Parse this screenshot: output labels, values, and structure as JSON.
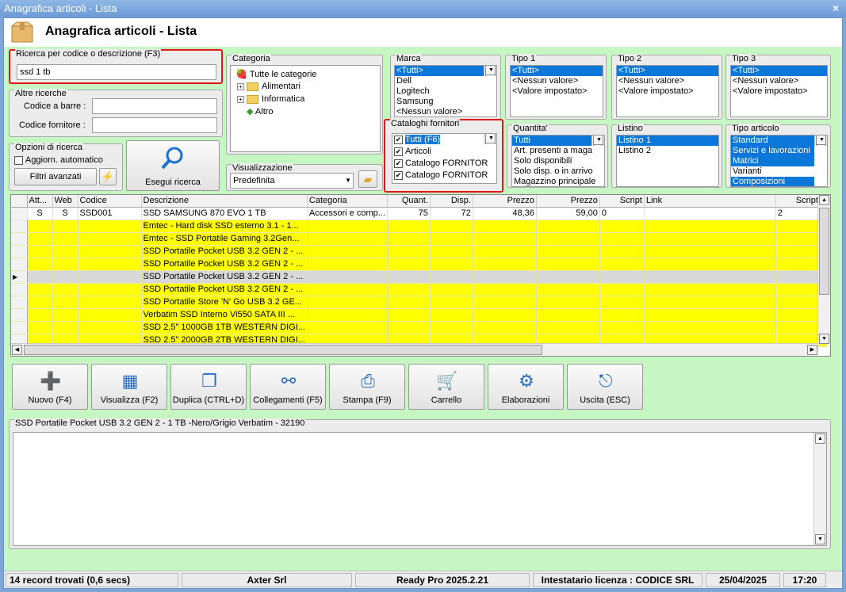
{
  "window": {
    "title": "Anagrafica articoli  - Lista",
    "close": "×"
  },
  "header": {
    "title": "Anagrafica articoli  - Lista"
  },
  "search": {
    "group": "Ricerca per codice o descrizione (F3)",
    "value": "ssd 1 tb"
  },
  "altre": {
    "group": "Altre ricerche",
    "barcode_label": "Codice a barre :",
    "supplier_label": "Codice fornitore :"
  },
  "opzioni": {
    "group": "Opzioni di ricerca",
    "auto_update": "Aggiorn. automatico",
    "filters": "Filtri avanzati"
  },
  "esegui": {
    "label": "Esegui ricerca"
  },
  "categoria": {
    "group": "Categoria",
    "root": "Tutte le categorie",
    "items": [
      "Alimentari",
      "Informatica",
      "Altro"
    ]
  },
  "visualizzazione": {
    "group": "Visualizzazione",
    "value": "Predefinita"
  },
  "marca": {
    "group": "Marca",
    "items": [
      "<Tutti>",
      "Dell",
      "Logitech",
      "Samsung",
      "<Nessun valore>"
    ]
  },
  "tipo1": {
    "group": "Tipo 1",
    "items": [
      "<Tutti>",
      "<Nessun valore>",
      "<Valore impostato>"
    ]
  },
  "tipo2": {
    "group": "Tipo 2",
    "items": [
      "<Tutti>",
      "<Nessun valore>",
      "<Valore impostato>"
    ]
  },
  "tipo3": {
    "group": "Tipo 3",
    "items": [
      "<Tutti>",
      "<Nessun valore>",
      "<Valore impostato>"
    ]
  },
  "cataloghi": {
    "group": "Cataloghi fornitori",
    "items": [
      "Tutti (F6)",
      "Articoli",
      "Catalogo FORNITOR",
      "Catalogo FORNITOR"
    ]
  },
  "quantita": {
    "group": "Quantita'",
    "items": [
      "Tutti",
      "Art. presenti a maga",
      "Solo disponibili",
      "Solo disp. o in arrivo",
      "Magazzino principale"
    ]
  },
  "listino": {
    "group": "Listino",
    "items": [
      "Listino 1",
      "Listino 2"
    ]
  },
  "tipo_articolo": {
    "group": "Tipo articolo",
    "items": [
      "Standard",
      "Servizi e lavorazioni",
      "Matrici",
      "Varianti",
      "Composizioni"
    ]
  },
  "grid": {
    "columns": [
      "Att...",
      "Web",
      "Codice",
      "Descrizione",
      "Categoria",
      "Quant.",
      "Disp.",
      "Prezzo",
      "Prezzo",
      "Script",
      "Link",
      "Script",
      ""
    ],
    "rows": [
      [
        "S",
        "S",
        "SSD001",
        "SSD SAMSUNG 870 EVO 1 TB",
        "Accessori e comp...",
        "75",
        "72",
        "48,36",
        "59,00",
        "0",
        "",
        "2"
      ],
      [
        "",
        "",
        "",
        "Emtec - Hard disk SSD esterno 3.1 - 1...",
        "",
        "",
        "",
        "",
        "",
        "",
        "",
        ""
      ],
      [
        "",
        "",
        "",
        "Emtec - SSD Portatile Gaming 3.2Gen...",
        "",
        "",
        "",
        "",
        "",
        "",
        "",
        ""
      ],
      [
        "",
        "",
        "",
        "SSD Portatile Pocket USB 3.2 GEN 2 - ...",
        "",
        "",
        "",
        "",
        "",
        "",
        "",
        ""
      ],
      [
        "",
        "",
        "",
        "SSD Portatile Pocket USB 3.2 GEN 2 - ...",
        "",
        "",
        "",
        "",
        "",
        "",
        "",
        ""
      ],
      [
        "",
        "",
        "",
        "SSD Portatile Pocket USB 3.2 GEN 2 - ...",
        "",
        "",
        "",
        "",
        "",
        "",
        "",
        ""
      ],
      [
        "",
        "",
        "",
        "SSD Portatile Pocket USB 3.2 GEN 2 - ...",
        "",
        "",
        "",
        "",
        "",
        "",
        "",
        ""
      ],
      [
        "",
        "",
        "",
        "SSD Portatile Store 'N' Go USB 3.2 GE...",
        "",
        "",
        "",
        "",
        "",
        "",
        "",
        ""
      ],
      [
        "",
        "",
        "",
        "Verbatim SSD Interno Vi550 SATA III ...",
        "",
        "",
        "",
        "",
        "",
        "",
        "",
        ""
      ],
      [
        "",
        "",
        "",
        "SSD 2,5\" 1000GB 1TB WESTERN DIGI...",
        "",
        "",
        "",
        "",
        "",
        "",
        "",
        ""
      ],
      [
        "",
        "",
        "",
        "SSD 2.5\" 2000GB 2TB WESTERN DIGI...",
        "",
        "",
        "",
        "",
        "",
        "",
        "",
        ""
      ]
    ]
  },
  "toolbar": [
    "Nuovo (F4)",
    "Visualizza (F2)",
    "Duplica (CTRL+D)",
    "Collegamenti (F5)",
    "Stampa (F9)",
    "Carrello",
    "Elaborazioni",
    "Uscita (ESC)"
  ],
  "detail": {
    "title": "SSD Portatile Pocket USB 3.2 GEN 2 - 1 TB -Nero/Grigio Verbatim - 32190"
  },
  "status": {
    "records": "14 record trovati (0,6 secs)",
    "company": "Axter Srl",
    "version": "Ready Pro 2025.2.21",
    "license": "Intestatario licenza : CODICE SRL",
    "date": "25/04/2025",
    "time": "17:20"
  }
}
